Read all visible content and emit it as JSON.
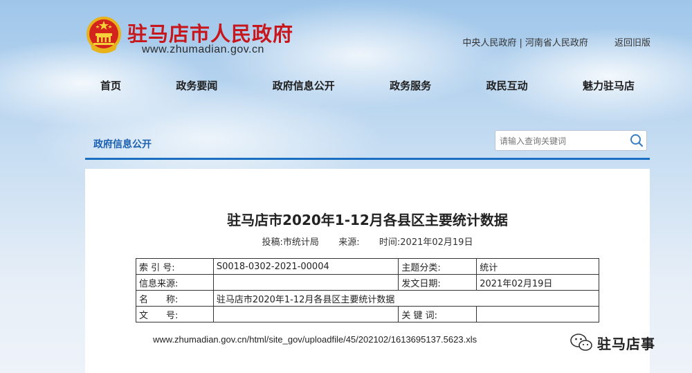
{
  "header": {
    "site_name": "驻马店市人民政府",
    "site_url": "www.zhumadian.gov.cn",
    "top_links": {
      "central_gov": "中央人民政府",
      "separator": "|",
      "provincial_gov": "河南省人民政府",
      "back_old": "返回旧版"
    }
  },
  "nav": {
    "items": [
      "首页",
      "政务要闻",
      "政府信息公开",
      "政务服务",
      "政民互动",
      "魅力驻马店"
    ]
  },
  "subbar": {
    "breadcrumb": "政府信息公开",
    "search_placeholder": "请输入查询关键词"
  },
  "document": {
    "title": "驻马店市2020年1-12月各县区主要统计数据",
    "meta": {
      "author_label": "投稿:",
      "author": "市统计局",
      "source_label": "来源:",
      "source": "",
      "time_label": "时间:",
      "time": "2021年02月19日"
    },
    "info_table": {
      "index_label": "索 引 号:",
      "index_value": "S0018-0302-2021-00004",
      "topic_label": "主题分类:",
      "topic_value": "统计",
      "info_source_label": "信息来源:",
      "info_source_value": "",
      "issue_date_label": "发文日期:",
      "issue_date_value": "2021年02月19日",
      "name_label": "名　　称:",
      "name_value": "驻马店市2020年1-12月各县区主要统计数据",
      "doc_no_label": "文　　号:",
      "doc_no_value": "",
      "keywords_label": "关 键 词:",
      "keywords_value": ""
    },
    "file_link": "www.zhumadian.gov.cn/html/site_gov/uploadfile/45/202102/1613695137.5623.xls"
  },
  "watermark": {
    "text": "驻马店事",
    "icon": "wechat-icon"
  },
  "colors": {
    "brand_red": "#c8161d",
    "accent_blue": "#1a6fc2"
  }
}
